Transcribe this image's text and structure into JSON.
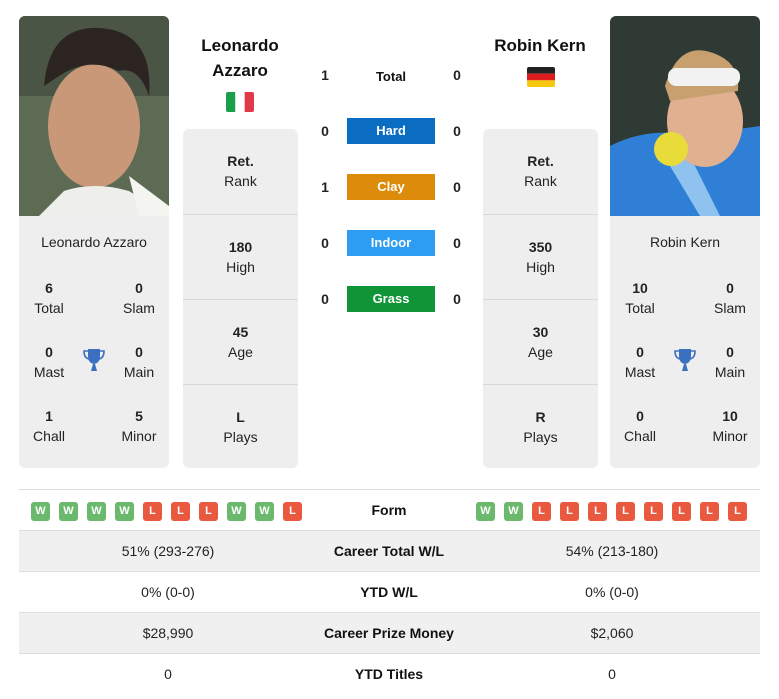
{
  "player1": {
    "name_line1": "Leonardo",
    "name_line2": "Azzaro",
    "full_name": "Leonardo Azzaro",
    "flag": "italy-flag",
    "stats": {
      "total": "6",
      "total_label": "Total",
      "slam": "0",
      "slam_label": "Slam",
      "mast": "0",
      "mast_label": "Mast",
      "main": "0",
      "main_label": "Main",
      "chall": "1",
      "chall_label": "Chall",
      "minor": "5",
      "minor_label": "Minor"
    },
    "info": [
      {
        "value": "Ret.",
        "label": "Rank"
      },
      {
        "value": "180",
        "label": "High"
      },
      {
        "value": "45",
        "label": "Age"
      },
      {
        "value": "L",
        "label": "Plays"
      }
    ],
    "form": [
      "W",
      "W",
      "W",
      "W",
      "L",
      "L",
      "L",
      "W",
      "W",
      "L"
    ]
  },
  "player2": {
    "name": "Robin Kern",
    "full_name": "Robin Kern",
    "flag": "germany-flag",
    "stats": {
      "total": "10",
      "total_label": "Total",
      "slam": "0",
      "slam_label": "Slam",
      "mast": "0",
      "mast_label": "Mast",
      "main": "0",
      "main_label": "Main",
      "chall": "0",
      "chall_label": "Chall",
      "minor": "10",
      "minor_label": "Minor"
    },
    "info": [
      {
        "value": "Ret.",
        "label": "Rank"
      },
      {
        "value": "350",
        "label": "High"
      },
      {
        "value": "30",
        "label": "Age"
      },
      {
        "value": "R",
        "label": "Plays"
      }
    ],
    "form": [
      "W",
      "W",
      "L",
      "L",
      "L",
      "L",
      "L",
      "L",
      "L",
      "L"
    ]
  },
  "h2h": {
    "total": {
      "label": "Total",
      "p1": "1",
      "p2": "0"
    },
    "surfaces": [
      {
        "label": "Hard",
        "p1": "0",
        "p2": "0",
        "color": "#0a6dc2"
      },
      {
        "label": "Clay",
        "p1": "1",
        "p2": "0",
        "color": "#dc8c0a"
      },
      {
        "label": "Indoor",
        "p1": "0",
        "p2": "0",
        "color": "#2c9df2"
      },
      {
        "label": "Grass",
        "p1": "0",
        "p2": "0",
        "color": "#0f9438"
      }
    ]
  },
  "form_label": "Form",
  "comparison": [
    {
      "label": "Career Total W/L",
      "p1": "51% (293-276)",
      "p2": "54% (213-180)"
    },
    {
      "label": "YTD W/L",
      "p1": "0% (0-0)",
      "p2": "0% (0-0)"
    },
    {
      "label": "Career Prize Money",
      "p1": "$28,990",
      "p2": "$2,060"
    },
    {
      "label": "YTD Titles",
      "p1": "0",
      "p2": "0"
    }
  ]
}
